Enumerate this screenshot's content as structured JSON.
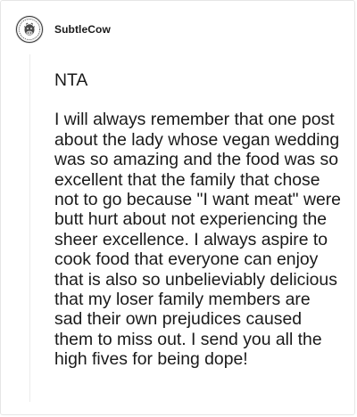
{
  "comment": {
    "username": "SubtleCow",
    "avatar_icon": "cow-avatar-icon",
    "paragraphs": [
      "NTA",
      "I will always remember that one post about the lady whose vegan wedding was so amazing and the food was so excellent that the family that chose not to go because \"I want meat\" were butt hurt about not experiencing the sheer excellence. I always aspire to cook food that everyone can enjoy that is also so unbelieviably delicious that my loser family members are sad their own prejudices caused them to miss out. I send you all the high fives for being dope!"
    ]
  },
  "colors": {
    "text": "#1a1a1a",
    "border": "#e6e6e6",
    "thread_line": "#ececec"
  }
}
